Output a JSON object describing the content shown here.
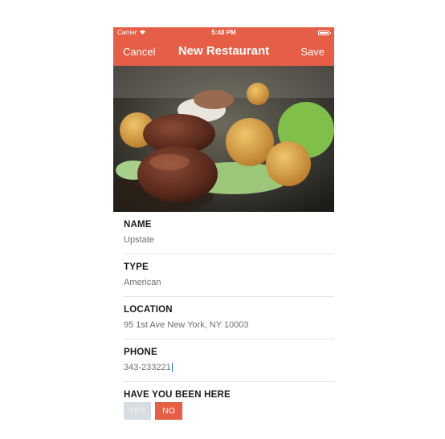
{
  "status_bar": {
    "carrier": "Carrier",
    "time": "5:48 PM"
  },
  "nav": {
    "cancel_label": "Cancel",
    "title": "New Restaurant",
    "save_label": "Save"
  },
  "form": {
    "fields": [
      {
        "label": "NAME",
        "value": "Upstate"
      },
      {
        "label": "TYPE",
        "value": "American"
      },
      {
        "label": "LOCATION",
        "value": "95 1st Ave New York, NY 10003"
      },
      {
        "label": "PHONE",
        "value": "343-233221"
      }
    ],
    "visited": {
      "label": "HAVE YOU BEEN HERE",
      "yes_label": "YES",
      "no_label": "NO",
      "selected": "NO"
    }
  },
  "colors": {
    "accent": "#e65e45",
    "unselected_button": "#d8dde2"
  }
}
